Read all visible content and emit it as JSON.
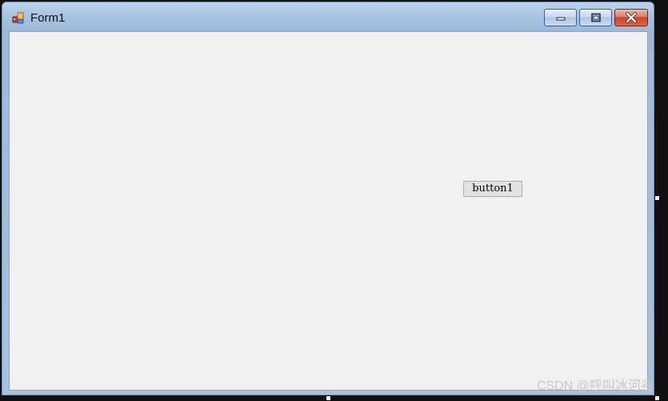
{
  "window": {
    "title": "Form1",
    "icon": "form-app-icon",
    "controls": {
      "minimize": "minimize-icon",
      "maximize": "maximize-icon",
      "close": "close-icon"
    }
  },
  "form": {
    "button1_label": "button1"
  },
  "watermark": {
    "text": "CSDN @呼叫冰河谷"
  },
  "colors": {
    "client_background": "#f0f0f0",
    "title_bar": "#a8c3e1",
    "close_button": "#c8452b"
  }
}
